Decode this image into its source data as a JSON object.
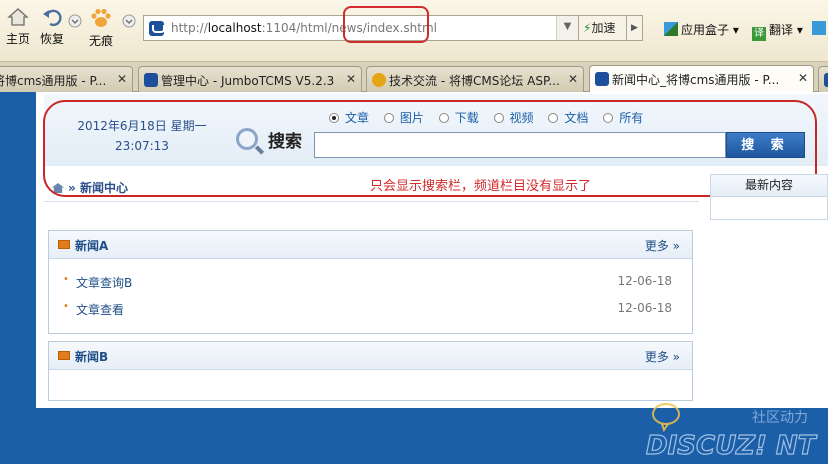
{
  "toolbar": {
    "home_label": "主页",
    "restore_label": "恢复",
    "notrace_label": "无痕",
    "url_plain_prefix": "http://",
    "url_host": "localhost",
    "url_rest": ":1104/html/news/index.shtml",
    "speed_label": "加速",
    "appbox_label": "应用盒子",
    "translate_label": "翻译"
  },
  "tabs": [
    {
      "label": "将博cms通用版 - P...",
      "favicon": "site-icon"
    },
    {
      "label": "管理中心 - JumboTCMS V5.2.3",
      "favicon": "site-icon"
    },
    {
      "label": "技术交流 - 将博CMS论坛 ASP...",
      "favicon": "star-icon"
    },
    {
      "label": "新闻中心_将博cms通用版 - P...",
      "favicon": "site-icon",
      "active": true
    }
  ],
  "page": {
    "date_line1": "2012年6月18日  星期一",
    "date_line2": "23:07:13",
    "search_types": [
      "文章",
      "图片",
      "下载",
      "视频",
      "文档",
      "所有"
    ],
    "search_selected": "文章",
    "search_label": "搜索",
    "search_button": "搜 索",
    "breadcrumb": "新闻中心",
    "breadcrumb_sep": "»",
    "annotation": "只会显示搜索栏，频道栏目没有显示了",
    "sidebar_title": "最新内容",
    "boxes": [
      {
        "title": "新闻A",
        "more": "更多",
        "items": [
          {
            "title": "文章查询B",
            "date": "12-06-18"
          },
          {
            "title": "文章查看",
            "date": "12-06-18"
          }
        ]
      },
      {
        "title": "新闻B",
        "more": "更多",
        "items": []
      }
    ]
  },
  "watermark": {
    "top": "社区动力",
    "bottom": "DISCUZ! NT"
  },
  "colors": {
    "background_blue": "#1a5fa8",
    "annotation_red": "#d12b2b"
  }
}
